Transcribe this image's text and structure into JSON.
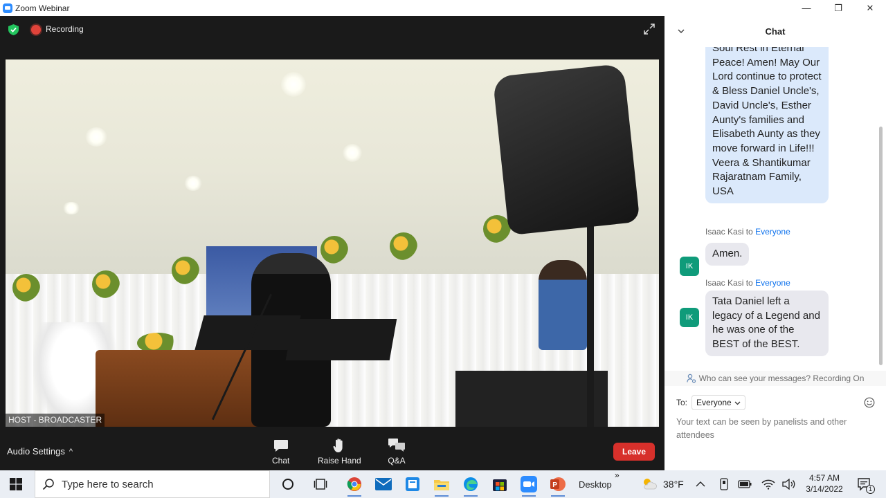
{
  "window": {
    "title": "Zoom Webinar",
    "minimize": "—",
    "restore": "❐",
    "close": "✕"
  },
  "meeting": {
    "recording_label": "Recording",
    "host_label": "HOST - BROADCASTER",
    "audio_settings_label": "Audio Settings",
    "audio_caret": "^",
    "controls": {
      "chat": "Chat",
      "raise_hand": "Raise Hand",
      "qa": "Q&A",
      "leave": "Leave"
    }
  },
  "chat": {
    "title": "Chat",
    "messages": [
      {
        "text": "Soul Rest in Eternal Peace! Amen! May Our Lord continue to protect & Bless Daniel Uncle's, David Uncle's, Esther Aunty's families and Elisabeth Aunty as they move forward in Life!!! Veera & Shantikumar Rajaratnam Family, USA"
      },
      {
        "sender": "Isaac Kasi",
        "to_word": "to",
        "recipient": "Everyone",
        "avatar": "IK",
        "text": "Amen."
      },
      {
        "sender": "Isaac Kasi",
        "to_word": "to",
        "recipient": "Everyone",
        "avatar": "IK",
        "text": "Tata Daniel left a legacy of a Legend and he was one of the BEST of the BEST."
      }
    ],
    "privacy_note": "Who can see your messages? Recording On",
    "to_label": "To:",
    "to_value": "Everyone",
    "input_placeholder": "Your text can be seen by panelists and other attendees"
  },
  "taskbar": {
    "search_placeholder": "Type here to search",
    "desktop_label": "Desktop",
    "chevrons": "»",
    "weather": "38°F",
    "time": "4:57 AM",
    "date": "3/14/2022",
    "notification_count": "1"
  }
}
